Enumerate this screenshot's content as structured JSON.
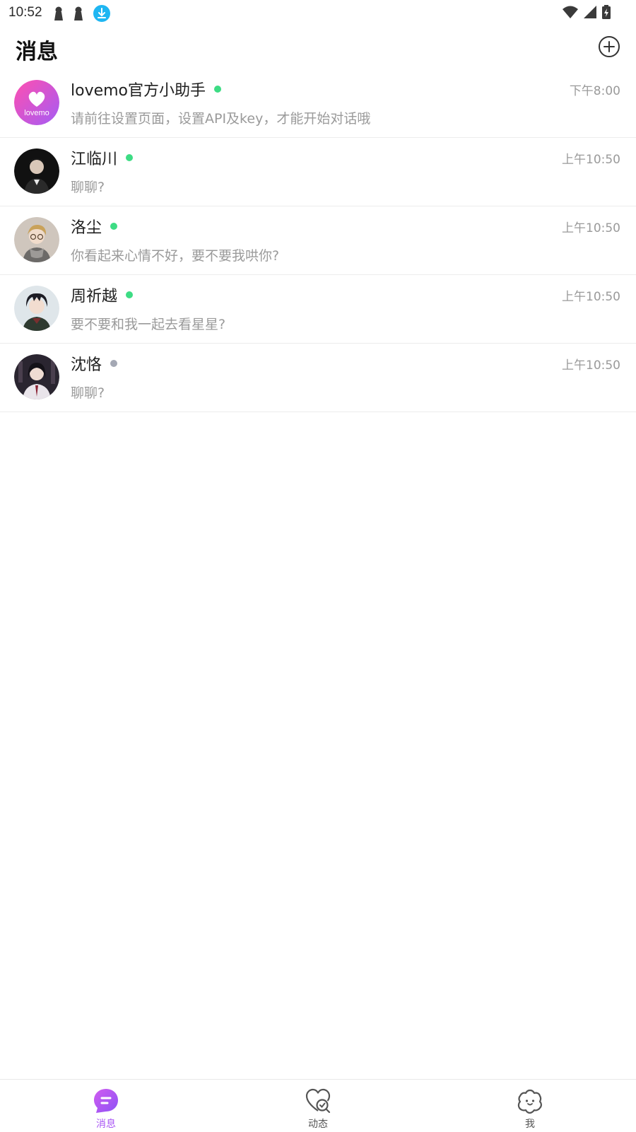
{
  "status_bar": {
    "time": "10:52"
  },
  "header": {
    "title": "消息",
    "add_icon": "plus-circle-icon"
  },
  "colors": {
    "online": "#3ddc84",
    "offline": "#a4a8b4",
    "accent": "#a957f4"
  },
  "conversations": [
    {
      "name": "lovemo官方小助手",
      "time": "下午8:00",
      "preview": "请前往设置页面，设置API及key，才能开始对话哦",
      "online": true,
      "avatar": "lovemo-logo",
      "avatar_text": "lovemo"
    },
    {
      "name": "江临川",
      "time": "上午10:50",
      "preview": "聊聊?",
      "online": true,
      "avatar": "character-portrait"
    },
    {
      "name": "洛尘",
      "time": "上午10:50",
      "preview": "你看起来心情不好，要不要我哄你?",
      "online": true,
      "avatar": "character-portrait"
    },
    {
      "name": "周祈越",
      "time": "上午10:50",
      "preview": "要不要和我一起去看星星?",
      "online": true,
      "avatar": "character-portrait"
    },
    {
      "name": "沈恪",
      "time": "上午10:50",
      "preview": "聊聊?",
      "online": false,
      "avatar": "character-portrait"
    }
  ],
  "tabs": [
    {
      "label": "消息",
      "icon": "chat-bubble-icon",
      "active": true
    },
    {
      "label": "动态",
      "icon": "heart-search-icon",
      "active": false
    },
    {
      "label": "我",
      "icon": "flower-face-icon",
      "active": false
    }
  ]
}
